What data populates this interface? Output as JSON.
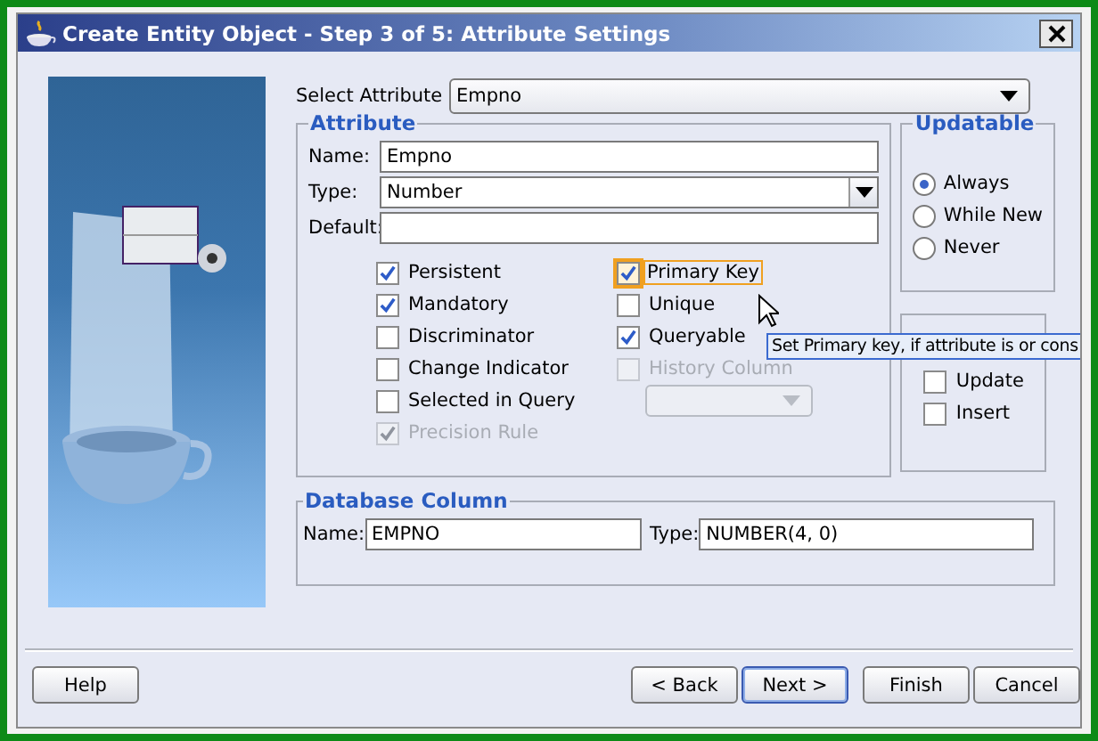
{
  "window": {
    "title": "Create Entity Object - Step 3 of 5: Attribute Settings"
  },
  "select_attribute": {
    "label": "Select Attribute",
    "value": "Empno"
  },
  "attribute": {
    "title": "Attribute",
    "fields": [
      {
        "label": "Name:",
        "value": "Empno",
        "kind": "text"
      },
      {
        "label": "Type:",
        "value": "Number",
        "kind": "combo"
      },
      {
        "label": "Default:",
        "kind": "text"
      }
    ],
    "checkbox_columns": [
      {
        "items": [
          {
            "label": "Persistent",
            "checked": true,
            "disabled": false,
            "focused": false
          },
          {
            "label": "Mandatory",
            "checked": true,
            "disabled": false,
            "focused": false
          },
          {
            "label": "Discriminator",
            "checked": false,
            "disabled": false,
            "focused": false
          },
          {
            "label": "Change Indicator",
            "checked": false,
            "disabled": false,
            "focused": false
          },
          {
            "label": "Selected in Query",
            "checked": false,
            "disabled": false,
            "focused": false
          },
          {
            "label": "Precision Rule",
            "checked": true,
            "disabled": true,
            "focused": false
          }
        ]
      },
      {
        "items": [
          {
            "label": "Primary Key",
            "checked": true,
            "disabled": false,
            "focused": true
          },
          {
            "label": "Unique",
            "checked": false,
            "disabled": false,
            "focused": false
          },
          {
            "label": "Queryable",
            "checked": true,
            "disabled": false,
            "focused": false
          },
          {
            "label": "History Column",
            "checked": false,
            "disabled": true,
            "focused": false
          }
        ],
        "dropdown": {
          "disabled": true
        }
      }
    ]
  },
  "updatable": {
    "title": "Updatable",
    "options": [
      {
        "label": "Always",
        "selected": true
      },
      {
        "label": "While New",
        "selected": false
      },
      {
        "label": "Never",
        "selected": false
      }
    ]
  },
  "refresh_after": {
    "options": [
      {
        "label": "Update",
        "checked": false
      },
      {
        "label": "Insert",
        "checked": false
      }
    ]
  },
  "database_column": {
    "title": "Database Column",
    "fields": [
      {
        "label": "Name:",
        "value": "EMPNO"
      },
      {
        "label": "Type:",
        "value": "NUMBER(4, 0)"
      }
    ]
  },
  "tooltip": "Set Primary key, if attribute is or cons",
  "help_button": {
    "label": "Help"
  },
  "nav_buttons": [
    {
      "label": "< Back",
      "default": false
    },
    {
      "label": "Next >",
      "default": true
    },
    {
      "label": "Finish",
      "default": false
    },
    {
      "label": "Cancel",
      "default": false
    }
  ]
}
